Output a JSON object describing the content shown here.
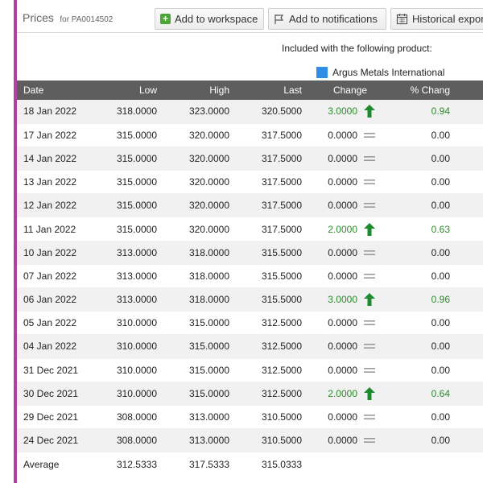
{
  "header": {
    "title": "Prices",
    "subtitle": "for PA0014502",
    "buttons": {
      "workspace": "Add to workspace",
      "notifications": "Add to notifications",
      "historical": "Historical expor"
    }
  },
  "included_label": "Included with the following product:",
  "product": {
    "name": "Argus Metals International",
    "color": "#2f8de6"
  },
  "colors": {
    "accent": "#b23fa3",
    "header_bg": "#5e5e5e",
    "positive": "#2c8a2c"
  },
  "table": {
    "columns": [
      "Date",
      "Low",
      "High",
      "Last",
      "Change",
      "% Chang"
    ],
    "rows": [
      {
        "date": "18 Jan 2022",
        "low": "318.0000",
        "high": "323.0000",
        "last": "320.5000",
        "change": "3.0000",
        "direction": "up",
        "pct": "0.94"
      },
      {
        "date": "17 Jan 2022",
        "low": "315.0000",
        "high": "320.0000",
        "last": "317.5000",
        "change": "0.0000",
        "direction": "flat",
        "pct": "0.00"
      },
      {
        "date": "14 Jan 2022",
        "low": "315.0000",
        "high": "320.0000",
        "last": "317.5000",
        "change": "0.0000",
        "direction": "flat",
        "pct": "0.00"
      },
      {
        "date": "13 Jan 2022",
        "low": "315.0000",
        "high": "320.0000",
        "last": "317.5000",
        "change": "0.0000",
        "direction": "flat",
        "pct": "0.00"
      },
      {
        "date": "12 Jan 2022",
        "low": "315.0000",
        "high": "320.0000",
        "last": "317.5000",
        "change": "0.0000",
        "direction": "flat",
        "pct": "0.00"
      },
      {
        "date": "11 Jan 2022",
        "low": "315.0000",
        "high": "320.0000",
        "last": "317.5000",
        "change": "2.0000",
        "direction": "up",
        "pct": "0.63"
      },
      {
        "date": "10 Jan 2022",
        "low": "313.0000",
        "high": "318.0000",
        "last": "315.5000",
        "change": "0.0000",
        "direction": "flat",
        "pct": "0.00"
      },
      {
        "date": "07 Jan 2022",
        "low": "313.0000",
        "high": "318.0000",
        "last": "315.5000",
        "change": "0.0000",
        "direction": "flat",
        "pct": "0.00"
      },
      {
        "date": "06 Jan 2022",
        "low": "313.0000",
        "high": "318.0000",
        "last": "315.5000",
        "change": "3.0000",
        "direction": "up",
        "pct": "0.96"
      },
      {
        "date": "05 Jan 2022",
        "low": "310.0000",
        "high": "315.0000",
        "last": "312.5000",
        "change": "0.0000",
        "direction": "flat",
        "pct": "0.00"
      },
      {
        "date": "04 Jan 2022",
        "low": "310.0000",
        "high": "315.0000",
        "last": "312.5000",
        "change": "0.0000",
        "direction": "flat",
        "pct": "0.00"
      },
      {
        "date": "31 Dec 2021",
        "low": "310.0000",
        "high": "315.0000",
        "last": "312.5000",
        "change": "0.0000",
        "direction": "flat",
        "pct": "0.00"
      },
      {
        "date": "30 Dec 2021",
        "low": "310.0000",
        "high": "315.0000",
        "last": "312.5000",
        "change": "2.0000",
        "direction": "up",
        "pct": "0.64"
      },
      {
        "date": "29 Dec 2021",
        "low": "308.0000",
        "high": "313.0000",
        "last": "310.5000",
        "change": "0.0000",
        "direction": "flat",
        "pct": "0.00"
      },
      {
        "date": "24 Dec 2021",
        "low": "308.0000",
        "high": "313.0000",
        "last": "310.5000",
        "change": "0.0000",
        "direction": "flat",
        "pct": "0.00"
      }
    ],
    "average": {
      "label": "Average",
      "low": "312.5333",
      "high": "317.5333",
      "last": "315.0333"
    }
  }
}
